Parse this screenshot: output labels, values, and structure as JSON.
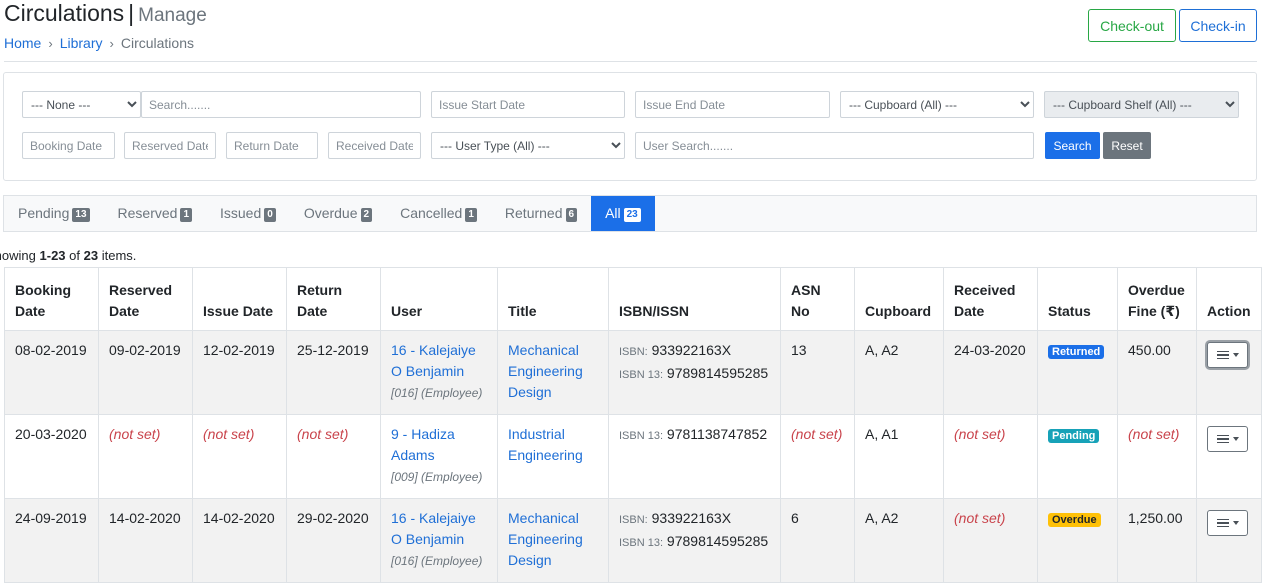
{
  "header": {
    "title": "Circulations",
    "separator": "|",
    "subtitle": "Manage",
    "breadcrumb": {
      "home": "Home",
      "library": "Library",
      "current": "Circulations",
      "sep": "›"
    },
    "checkout_label": "Check-out",
    "checkin_label": "Check-in"
  },
  "filters": {
    "type_select": "--- None ---",
    "search_placeholder": "Search.......",
    "issue_start_placeholder": "Issue Start Date",
    "issue_end_placeholder": "Issue End Date",
    "cupboard_select": "--- Cupboard (All) ---",
    "cupboard_shelf_select": "--- Cupboard Shelf (All) ---",
    "booking_date_placeholder": "Booking Date",
    "reserved_date_placeholder": "Reserved Date",
    "return_date_placeholder": "Return Date",
    "received_date_placeholder": "Received Date",
    "user_type_select": "--- User Type (All) ---",
    "user_search_placeholder": "User Search.......",
    "search_label": "Search",
    "reset_label": "Reset"
  },
  "tabs": [
    {
      "label": "Pending",
      "count": "13"
    },
    {
      "label": "Reserved",
      "count": "1"
    },
    {
      "label": "Issued",
      "count": "0"
    },
    {
      "label": "Overdue",
      "count": "2"
    },
    {
      "label": "Cancelled",
      "count": "1"
    },
    {
      "label": "Returned",
      "count": "6"
    },
    {
      "label": "All",
      "count": "23"
    }
  ],
  "summary": {
    "prefix": "ing",
    "range": "1-23",
    "of": "of",
    "total": "23",
    "suffix": "items."
  },
  "table": {
    "headers": {
      "booking": [
        "Booking",
        "Date"
      ],
      "reserved": [
        "Reserved",
        "Date"
      ],
      "issue": "Issue Date",
      "return": [
        "Return",
        "Date"
      ],
      "user": "User",
      "title": "Title",
      "isbn": "ISBN/ISSN",
      "asn": [
        "ASN",
        "No"
      ],
      "cupboard": "Cupboard",
      "received": [
        "Received",
        "Date"
      ],
      "status": "Status",
      "fine": [
        "Overdue",
        "Fine (₹)"
      ],
      "action": "Action"
    },
    "rows": [
      {
        "booking": "08-02-2019",
        "reserved": "09-02-2019",
        "issue": "12-02-2019",
        "return": "25-12-2019",
        "user_link": [
          "16 - Kalejaiye",
          "O Benjamin"
        ],
        "user_meta": "[016] (Employee)",
        "title": [
          "Mechanical",
          "Engineering",
          "Design"
        ],
        "isbn_label": "ISBN:",
        "isbn": "933922163X",
        "isbn13_label": "ISBN 13:",
        "isbn13": "9789814595285",
        "asn": "13",
        "cupboard": "A, A2",
        "received": "24-03-2020",
        "status": "Returned",
        "fine": "450.00"
      },
      {
        "booking": "20-03-2020",
        "reserved": "(not set)",
        "issue": "(not set)",
        "return": "(not set)",
        "user_link": [
          "9 - Hadiza",
          "Adams"
        ],
        "user_meta": "[009] (Employee)",
        "title": [
          "Industrial",
          "Engineering"
        ],
        "isbn13_label": "ISBN 13:",
        "isbn13": "9781138747852",
        "asn": "(not set)",
        "cupboard": "A, A1",
        "received": "(not set)",
        "status": "Pending",
        "fine": "(not set)"
      },
      {
        "booking": "24-09-2019",
        "reserved": "14-02-2020",
        "issue": "14-02-2020",
        "return": "29-02-2020",
        "user_link": [
          "16 - Kalejaiye",
          "O Benjamin"
        ],
        "user_meta": "[016] (Employee)",
        "title": [
          "Mechanical",
          "Engineering",
          "Design"
        ],
        "isbn_label": "ISBN:",
        "isbn": "933922163X",
        "isbn13_label": "ISBN 13:",
        "isbn13": "9789814595285",
        "asn": "6",
        "cupboard": "A, A2",
        "received": "(not set)",
        "status": "Overdue",
        "fine": "1,250.00"
      }
    ]
  },
  "colors": {
    "primary": "#1b6fe8",
    "success": "#28a745",
    "info": "#17a2b8",
    "warning": "#ffc107",
    "danger": "#c9434b",
    "secondary": "#6c757d"
  }
}
